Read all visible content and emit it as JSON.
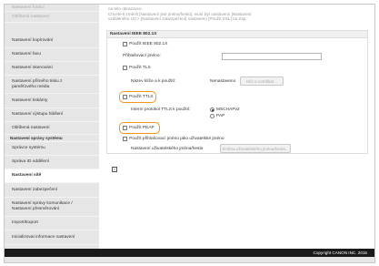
{
  "sidebar": {
    "items_top": [
      {
        "label": "Nastavení funkcí"
      },
      {
        "label": "Oblíbená nastavení"
      },
      {
        "label": "Nastavení kopírování"
      },
      {
        "label": "Nastavení faxu"
      },
      {
        "label": "Nastavení skenování"
      },
      {
        "label": "Nastavení přímého tisku z paměťového média"
      },
      {
        "label": "Nastavení tiskárny"
      },
      {
        "label": "Nastavení výstupu hlášení"
      },
      {
        "label": "Oblíbená nastavení"
      }
    ],
    "header": "Nastavení správy systému",
    "items_bottom": [
      {
        "label": "Správce systému"
      },
      {
        "label": "Správa ID oddělení"
      },
      {
        "label": "Nastavení sítě"
      },
      {
        "label": "Nastavení zabezpečení"
      },
      {
        "label": "Nastavení správy komunikace / Nastavení přesměrování"
      },
      {
        "label": "Import/Export"
      },
      {
        "label": "Inicializovat informace nastavení"
      }
    ]
  },
  "main": {
    "intro_lines": [
      "na této obrazovce.",
      "Chcete-li změnit [Nastavení jiné jméno/heslo], musí být nastaveno [Nastavení",
      "vzdáleného UI] > [Nastavení zabezpečení] nastaveno [Použít SSL] na Zap."
    ],
    "section_title": "Nastavení IEEE 802.1X",
    "use_ieee": "Použít IEEE 802.1X",
    "login_name_label": "Přihlašovací jméno:",
    "use_tls": "Použít TLS",
    "key_cert_label": "Název klíče a k použití:",
    "not_set": "Nenastaveno",
    "key_cert_button": "Klíč a certifikát...",
    "use_ttls": "Použít TTLS",
    "ttls_protocol_label": "Interní protokol TTLS k použití:",
    "mschapv2": "MSCHAPv2",
    "pap": "PAP",
    "use_peap": "Použít PEAP",
    "use_login_as_user": "Použít přihlašovací jméno jako uživatelské jméno",
    "user_pass_label": "Nastavení uživatelského jména/hesla",
    "user_pass_button": "Změna uživatelského jména/hesla..."
  },
  "footer": {
    "copyright": "Copyright CANON INC. 2015"
  },
  "colors": {
    "highlight": "#f7941d",
    "footer_bg": "#1a1a1a",
    "sidebar_bg": "#e6e6e6"
  },
  "icons": {
    "info": "info-icon"
  }
}
